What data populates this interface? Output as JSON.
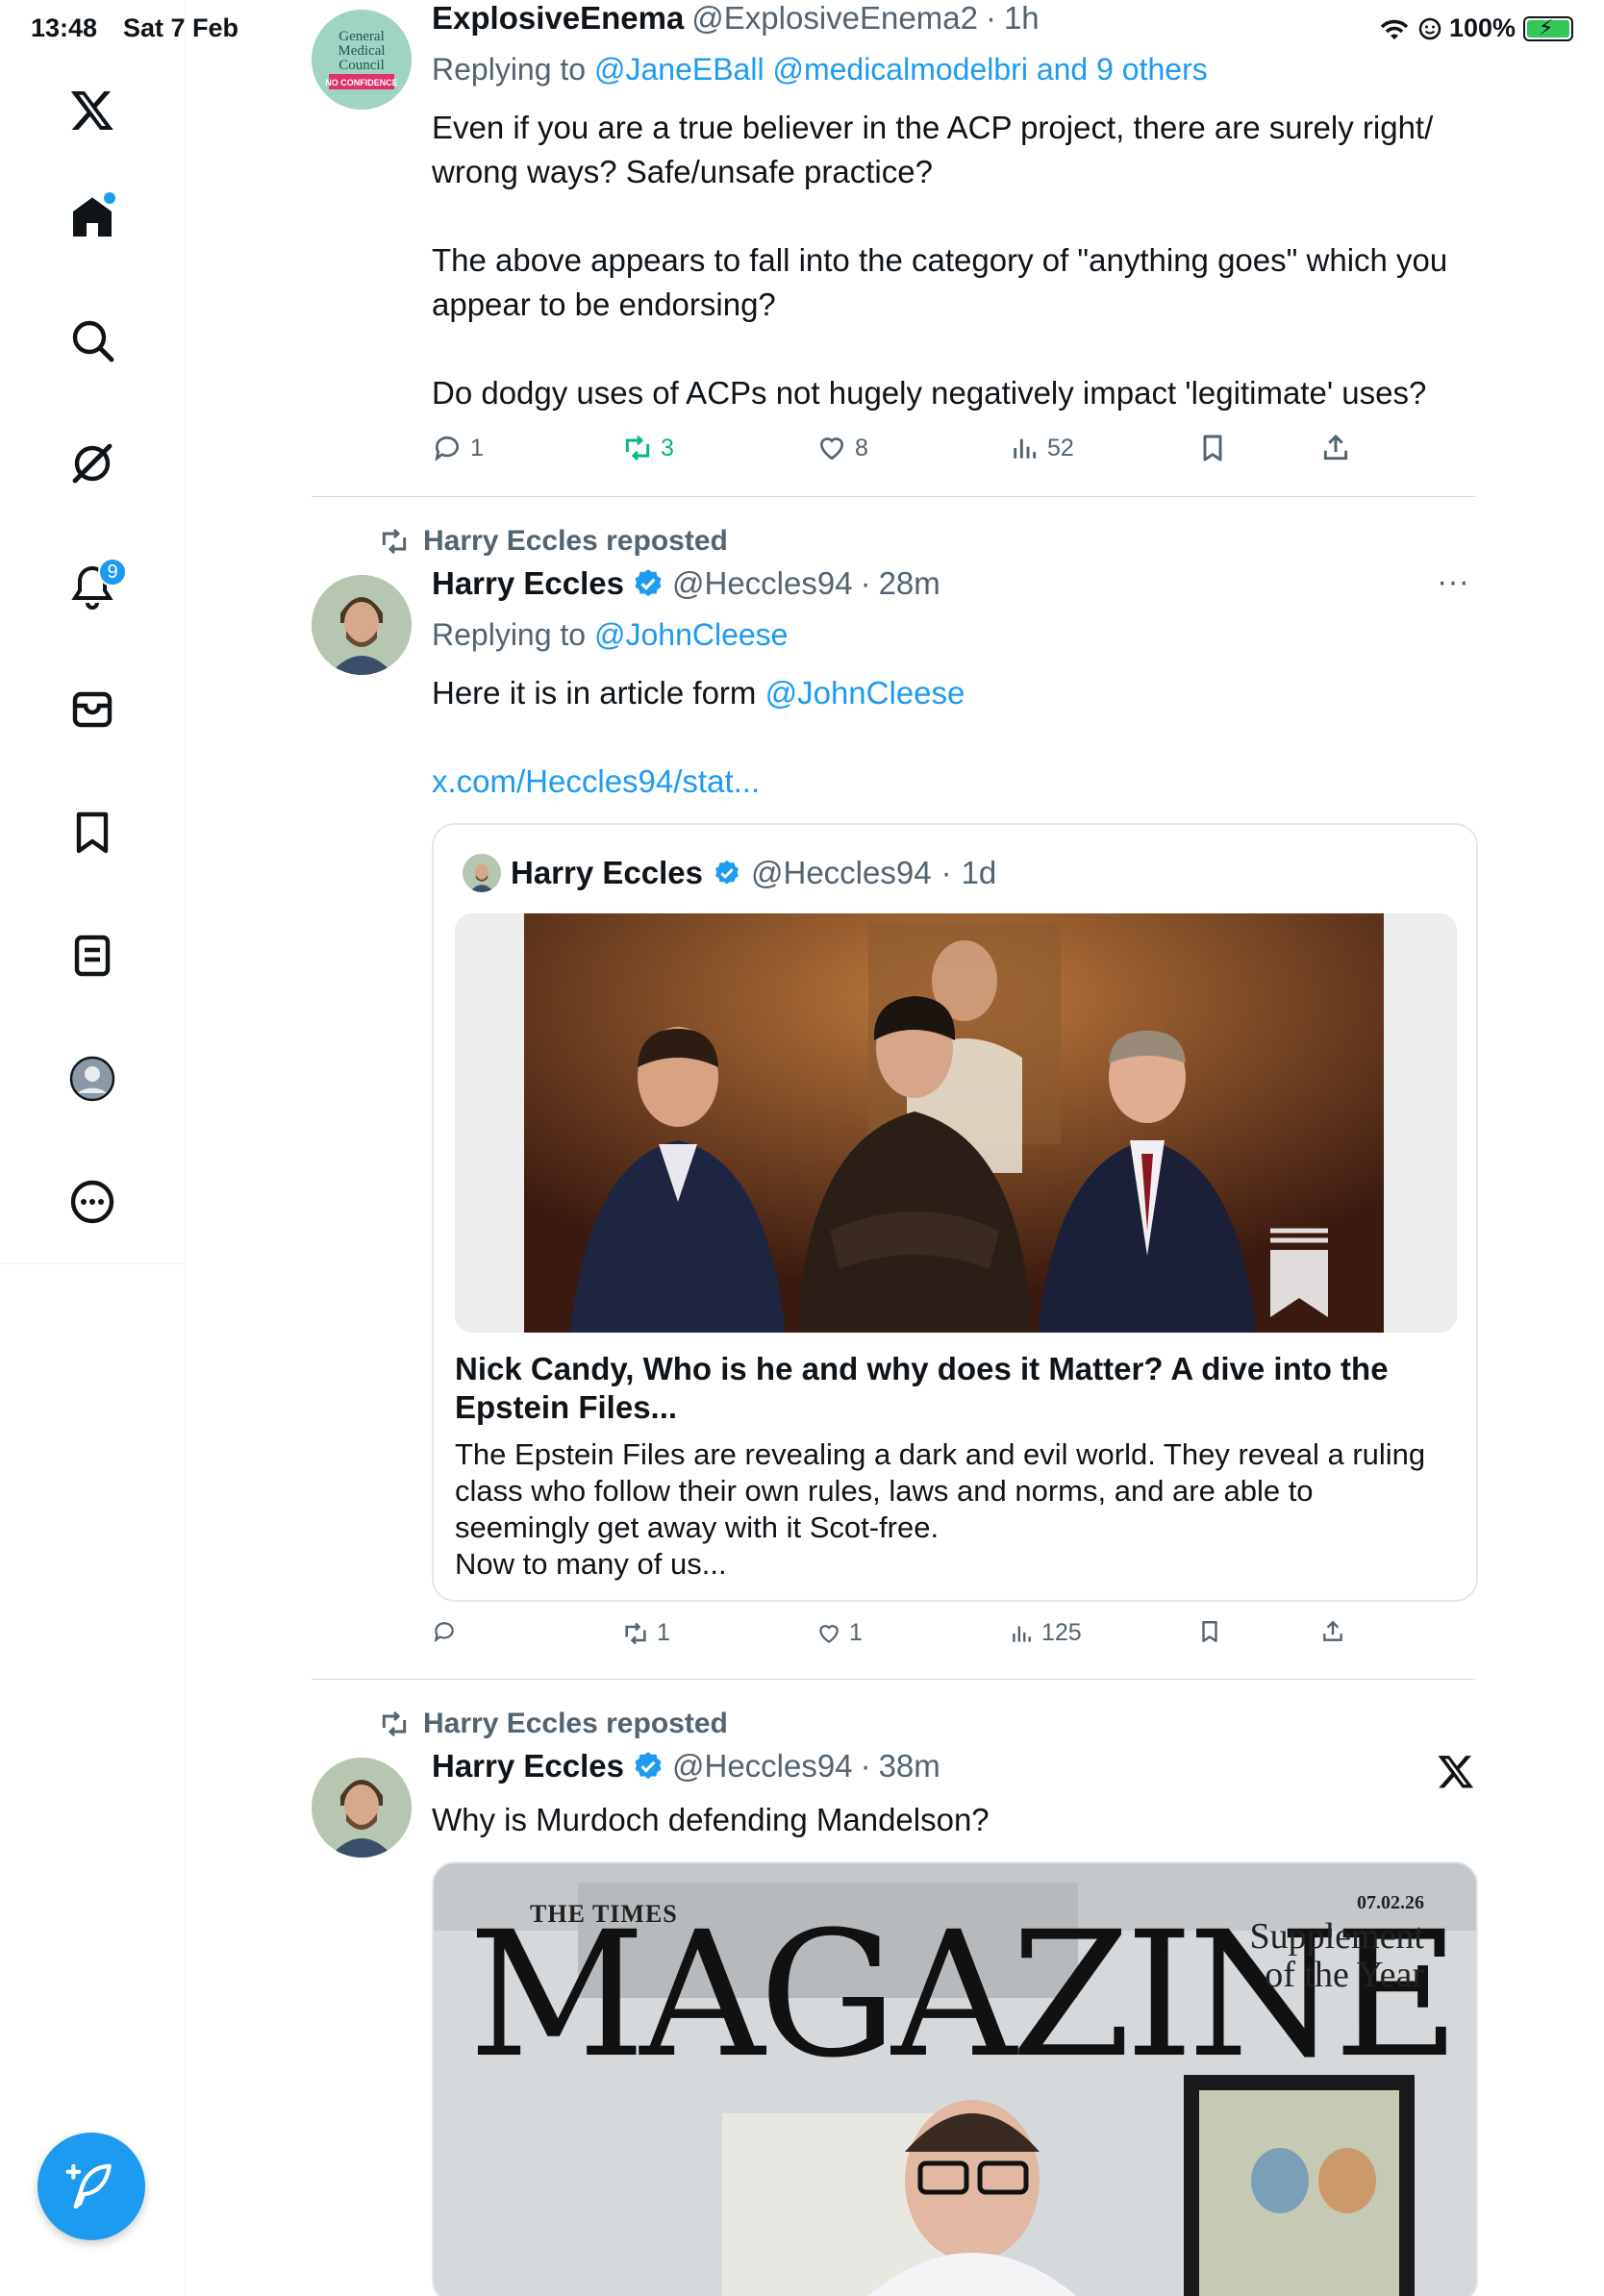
{
  "status": {
    "time": "13:48",
    "date": "Sat 7 Feb",
    "battery": "100%"
  },
  "sidebar": {
    "items": [
      {
        "name": "x-logo"
      },
      {
        "name": "home",
        "has_dot": true
      },
      {
        "name": "explore"
      },
      {
        "name": "grok"
      },
      {
        "name": "notifications",
        "badge": "9"
      },
      {
        "name": "messages"
      },
      {
        "name": "bookmarks"
      },
      {
        "name": "lists"
      },
      {
        "name": "profile"
      },
      {
        "name": "more"
      }
    ],
    "compose_icon": "compose-feather-icon"
  },
  "colors": {
    "accent": "#1d9bf0",
    "retweeted": "#00ba7c",
    "muted": "#536471"
  },
  "tweets": [
    {
      "name": "ExplosiveEnema",
      "handle": "@ExplosiveEnema2",
      "time": "1h",
      "replying_prefix": "Replying to",
      "replying_to": "@JaneEBall @medicalmodelbri and 9 others",
      "avatar_lines": [
        "General",
        "Medical",
        "Council",
        "NO CONFIDENCE"
      ],
      "paragraphs": [
        "Even if you are a true believer in the ACP project, there are surely right/ wrong ways? Safe/unsafe practice?",
        "The above appears to fall into the category of \"anything goes\" which you appear to be endorsing?",
        "Do dodgy uses of ACPs not hugely negatively impact 'legitimate' uses?"
      ],
      "stats": {
        "replies": "1",
        "reposts": "3",
        "likes": "8",
        "views": "52"
      }
    },
    {
      "repost_label": "Harry Eccles reposted",
      "name": "Harry Eccles",
      "handle": "@Heccles94",
      "time": "28m",
      "replying_prefix": "Replying to",
      "replying_to": "@JohnCleese",
      "text": "Here it is in article form",
      "mention": "@JohnCleese",
      "link": "x.com/Heccles94/stat...",
      "quote": {
        "name": "Harry Eccles",
        "handle": "@Heccles94",
        "time": "1d",
        "title": "Nick Candy, Who is he and why does it Matter? A dive into the Epstein Files...",
        "description": "The Epstein Files are revealing a dark and evil world. They reveal a ruling class who follow their own rules, laws and norms, and are able to seemingly get away with it Scot-free.",
        "description_more": "Now to many of us..."
      },
      "stats": {
        "replies": "",
        "reposts": "1",
        "likes": "1",
        "views": "125"
      }
    },
    {
      "repost_label": "Harry Eccles reposted",
      "name": "Harry Eccles",
      "handle": "@Heccles94",
      "time": "38m",
      "text": "Why is Murdoch defending Mandelson?",
      "magazine": {
        "masthead": "THE TIMES",
        "title": "MAGAZINE",
        "date": "07.02.26",
        "supplement_line1": "Supplement",
        "supplement_line2": "of the Year"
      }
    }
  ]
}
